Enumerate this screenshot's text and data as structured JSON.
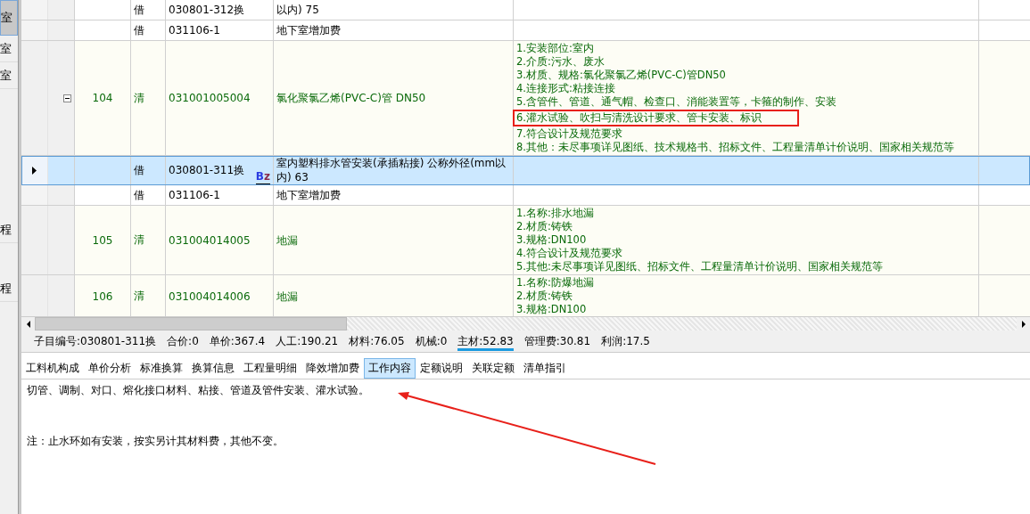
{
  "sidebar": {
    "items": [
      {
        "label": "室",
        "selected": true
      },
      {
        "label": "室",
        "selected": false
      },
      {
        "label": "室",
        "selected": false
      },
      {
        "label": "程",
        "selected": false
      },
      {
        "label": "程",
        "selected": false
      }
    ]
  },
  "grid": {
    "rows": [
      {
        "kind": "sub",
        "selected": false,
        "type": "借",
        "code": "030801-312换",
        "name": "以内) 75"
      },
      {
        "kind": "sub",
        "selected": false,
        "type": "借",
        "code": "031106-1",
        "name": "地下室增加费"
      },
      {
        "kind": "item",
        "expanded": true,
        "number": "104",
        "type": "清",
        "code": "031001005004",
        "name": "氯化聚氯乙烯(PVC-C)管 DN50",
        "features": [
          {
            "text": "1.安装部位:室内",
            "boxed": false
          },
          {
            "text": "2.介质:污水、废水",
            "boxed": false
          },
          {
            "text": "3.材质、规格:氯化聚氯乙烯(PVC-C)管DN50",
            "boxed": false
          },
          {
            "text": "4.连接形式:粘接连接",
            "boxed": false
          },
          {
            "text": "5.含管件、管道、通气帽、检查口、消能装置等，卡箍的制作、安装",
            "boxed": false
          },
          {
            "text": "6.灌水试验、吹扫与清洗设计要求、管卡安装、标识",
            "boxed": true
          },
          {
            "text": "7.符合设计及规范要求",
            "boxed": false
          },
          {
            "text": "8.其他：未尽事项详见图纸、技术规格书、招标文件、工程量清单计价说明、国家相关规范等",
            "boxed": false
          }
        ]
      },
      {
        "kind": "sub",
        "selected": true,
        "type": "借",
        "code": "030801-311换",
        "badge": "Bz",
        "name": "室内塑料排水管安装(承插粘接) 公称外径(mm以内) 63"
      },
      {
        "kind": "sub",
        "selected": false,
        "type": "借",
        "code": "031106-1",
        "name": "地下室增加费"
      },
      {
        "kind": "item",
        "number": "105",
        "type": "清",
        "code": "031004014005",
        "name": "地漏",
        "features": [
          {
            "text": "1.名称:排水地漏",
            "boxed": false
          },
          {
            "text": "2.材质:铸铁",
            "boxed": false
          },
          {
            "text": "3.规格:DN100",
            "boxed": false
          },
          {
            "text": "4.符合设计及规范要求",
            "boxed": false
          },
          {
            "text": "5.其他:未尽事项详见图纸、招标文件、工程量清单计价说明、国家相关规范等",
            "boxed": false
          }
        ]
      },
      {
        "kind": "item",
        "number": "106",
        "type": "清",
        "code": "031004014006",
        "name": "地漏",
        "features": [
          {
            "text": "1.名称:防爆地漏",
            "boxed": false
          },
          {
            "text": "2.材质:铸铁",
            "boxed": false
          },
          {
            "text": "3.规格:DN100",
            "boxed": false
          }
        ]
      }
    ]
  },
  "status_bar": [
    {
      "text": "子目编号:030801-311换",
      "highlighted": false
    },
    {
      "text": "合价:0",
      "highlighted": false
    },
    {
      "text": "单价:367.4",
      "highlighted": false
    },
    {
      "text": "人工:190.21",
      "highlighted": false
    },
    {
      "text": "材料:76.05",
      "highlighted": false
    },
    {
      "text": "机械:0",
      "highlighted": false
    },
    {
      "text": "主材:52.83",
      "highlighted": true
    },
    {
      "text": "管理费:30.81",
      "highlighted": false
    },
    {
      "text": "利润:17.5",
      "highlighted": false
    }
  ],
  "tabs": [
    {
      "label": "工料机构成",
      "selected": false
    },
    {
      "label": "单价分析",
      "selected": false
    },
    {
      "label": "标准换算",
      "selected": false
    },
    {
      "label": "换算信息",
      "selected": false
    },
    {
      "label": "工程量明细",
      "selected": false
    },
    {
      "label": "降效增加费",
      "selected": false
    },
    {
      "label": "工作内容",
      "selected": true
    },
    {
      "label": "定额说明",
      "selected": false
    },
    {
      "label": "关联定额",
      "selected": false
    },
    {
      "label": "清单指引",
      "selected": false
    }
  ],
  "content": {
    "paragraphs": [
      "切管、调制、对口、熔化接口材料、粘接、管道及管件安装、灌水试验。",
      "注：止水环如有安装，按实另计其材料费，其他不变。"
    ]
  },
  "annotation_arrow": true
}
